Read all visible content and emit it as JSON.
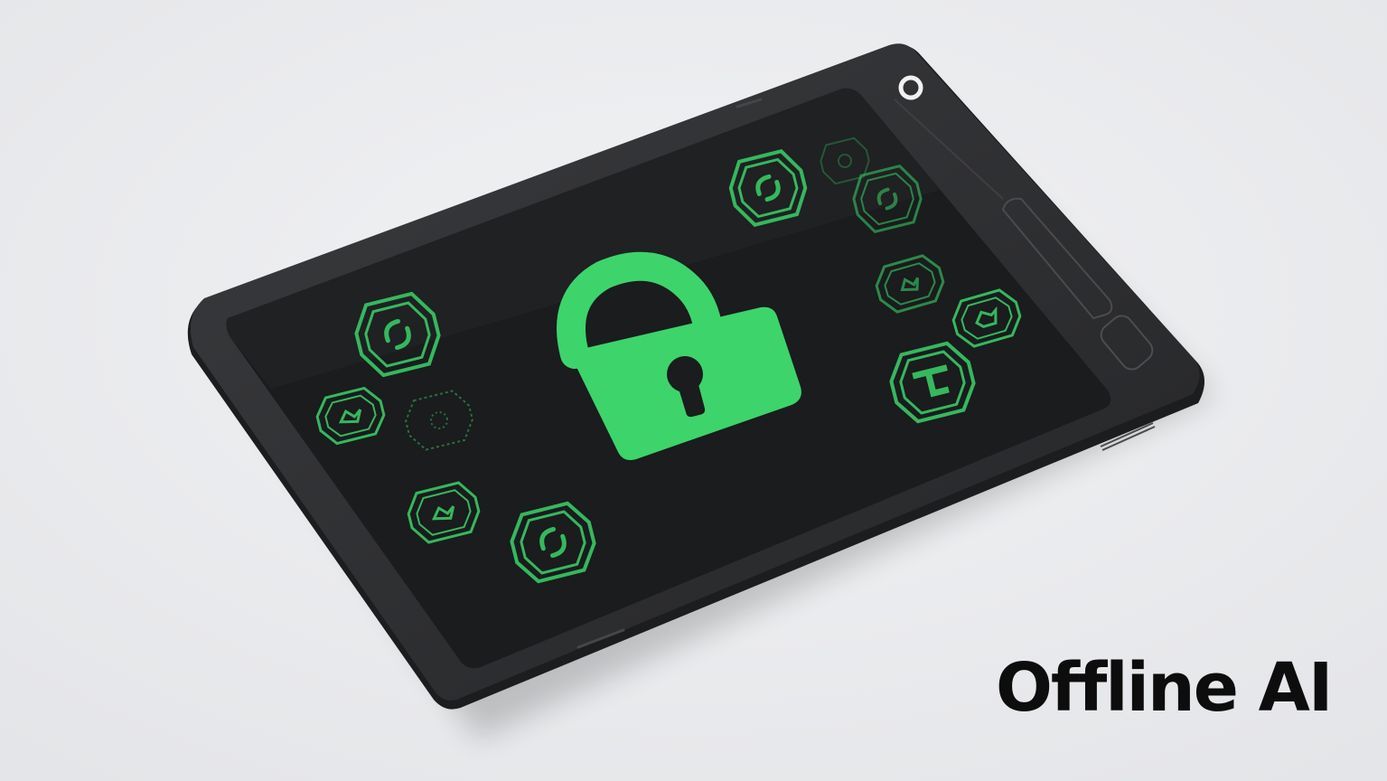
{
  "caption": "Offline AI",
  "colors": {
    "background": "#e9eaec",
    "device_body": "#2a2b2d",
    "device_edge": "#1d1e20",
    "screen": "#1a1c1d",
    "lock": "#3dd46c",
    "badge": "#35b85e",
    "caption_text": "#0d0d0d"
  },
  "icons": [
    "tablet-device",
    "padlock-icon",
    "sync-badge-icon",
    "puzzle-badge-icon",
    "dotted-badge-icon",
    "shield-badge-icon"
  ]
}
